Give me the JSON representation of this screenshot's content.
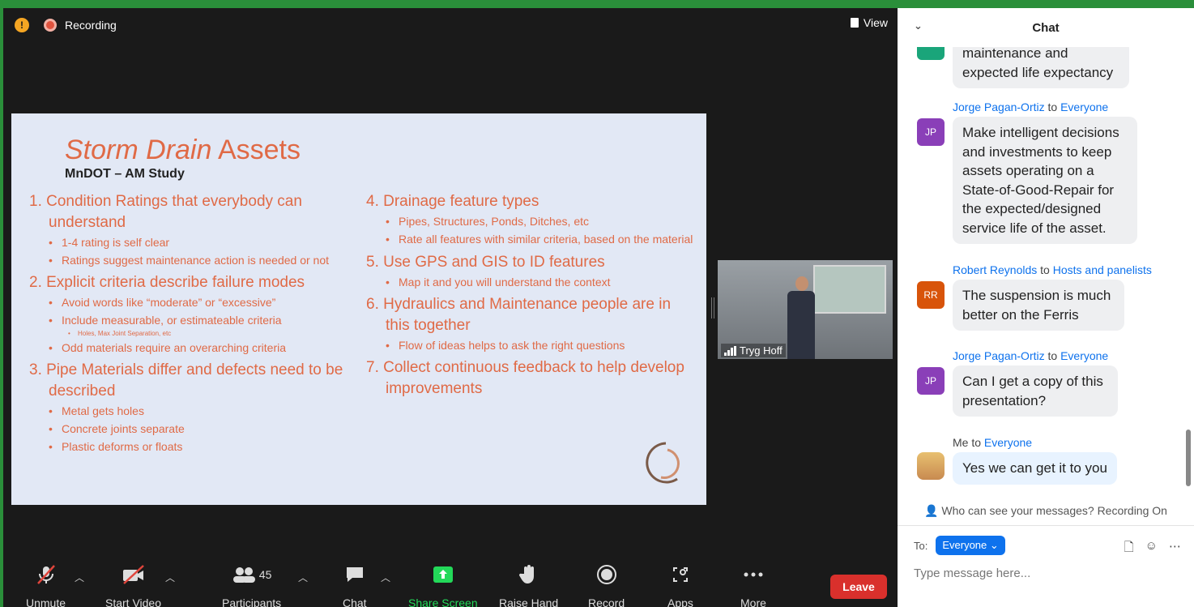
{
  "meeting": {
    "recording_label": "Recording",
    "view_label": "View"
  },
  "slide": {
    "title_italic": "Storm Drain",
    "title_rest": " Assets",
    "subtitle": "MnDOT – AM Study",
    "left": [
      {
        "num": "1. Condition Ratings that everybody can understand",
        "bullets": [
          "1-4 rating is self clear",
          "Ratings suggest maintenance action is needed or not"
        ]
      },
      {
        "num": "2. Explicit criteria describe failure modes",
        "bullets": [
          "Avoid words like “moderate” or “excessive”",
          "Include measurable, or estimateable criteria"
        ],
        "sub": "Holes, Max Joint Separation, etc",
        "bullets_after": [
          "Odd materials require an overarching criteria"
        ]
      },
      {
        "num": "3. Pipe Materials differ and defects need to be described",
        "bullets": [
          "Metal gets holes",
          "Concrete joints separate",
          "Plastic deforms or floats"
        ]
      }
    ],
    "right": [
      {
        "num": "4. Drainage feature types",
        "bullets": [
          "Pipes, Structures, Ponds, Ditches, etc",
          "Rate all features with similar criteria, based on the material"
        ]
      },
      {
        "num": "5. Use GPS and GIS to ID features",
        "bullets": [
          "Map it and you will understand the context"
        ]
      },
      {
        "num": "6. Hydraulics and Maintenance people are in this together",
        "bullets": [
          "Flow of ideas helps to ask the right questions"
        ]
      },
      {
        "num": "7. Collect continuous feedback to help develop improvements",
        "bullets": []
      }
    ]
  },
  "speaker": {
    "name": "Tryg Hoff"
  },
  "toolbar": {
    "unmute": "Unmute",
    "start_video": "Start Video",
    "participants": "Participants",
    "participants_count": "45",
    "chat": "Chat",
    "share_screen": "Share Screen",
    "raise_hand": "Raise Hand",
    "record": "Record",
    "apps": "Apps",
    "more": "More",
    "leave": "Leave"
  },
  "chat": {
    "title": "Chat",
    "partial_top": "maintenance and expected life expectancy",
    "messages": [
      {
        "sender": "Jorge Pagan-Ortiz",
        "to_word": " to ",
        "recipient": "Everyone",
        "initials": "JP",
        "text": "Make intelligent decisions and investments to keep assets operating on a State-of-Good-Repair for the expected/designed service life of the asset."
      },
      {
        "sender": "Robert Reynolds",
        "to_word": " to ",
        "recipient": "Hosts and panelists",
        "initials": "RR",
        "text": "The suspension is much better on the Ferris"
      },
      {
        "sender": "Jorge Pagan-Ortiz",
        "to_word": " to ",
        "recipient": "Everyone",
        "initials": "JP",
        "text": "Can I get a copy of this presentation?"
      },
      {
        "sender": "Me",
        "to_word": " to ",
        "recipient": "Everyone",
        "initials": "",
        "text": "Yes we can get it to you"
      }
    ],
    "who_can_see": "Who can see your messages? Recording On",
    "to_label": "To:",
    "to_value": "Everyone",
    "placeholder": "Type message here..."
  },
  "colors": {
    "accent": "#0e72ed",
    "slide_text": "#e06a46",
    "leave": "#d9302c",
    "share_green": "#23d959"
  }
}
